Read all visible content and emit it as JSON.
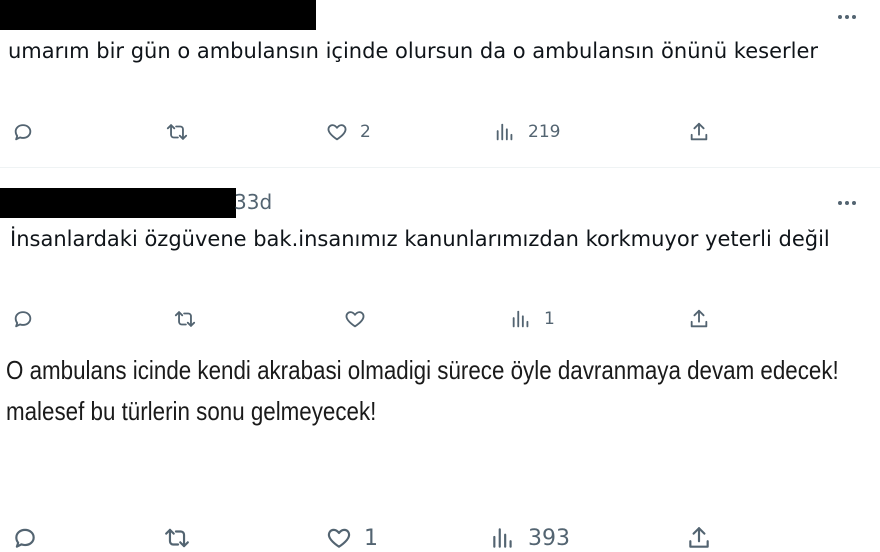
{
  "tweets": [
    {
      "handle_fragment": "",
      "text": "umarım bir gün o ambulansın içinde olursun da o ambulansın önünü keserler",
      "actions": {
        "reply": "",
        "retweet": "",
        "like": "2",
        "views": "219",
        "share": ""
      }
    },
    {
      "handle_fragment": "33d",
      "text": "İnsanlardaki özgüvene bak.insanımız kanunlarımızdan korkmuyor yeterli değil",
      "actions": {
        "reply": "",
        "retweet": "",
        "like": "",
        "views": "1",
        "share": ""
      }
    },
    {
      "handle_fragment": "",
      "text": "O ambulans icinde kendi akrabasi olmadigi sürece öyle davranmaya devam edecek!\nmalesef bu türlerin sonu gelmeyecek!",
      "actions": {
        "reply": "",
        "retweet": "",
        "like": "1",
        "views": "393",
        "share": ""
      }
    }
  ],
  "icons": {
    "reply": "reply-icon",
    "retweet": "retweet-icon",
    "like": "heart-icon",
    "views": "views-chart-icon",
    "share": "share-icon",
    "more": "more-options-icon"
  },
  "colors": {
    "text": "#0f1419",
    "secondary": "#536471",
    "divider": "#eff3f4",
    "redaction": "#000000"
  }
}
